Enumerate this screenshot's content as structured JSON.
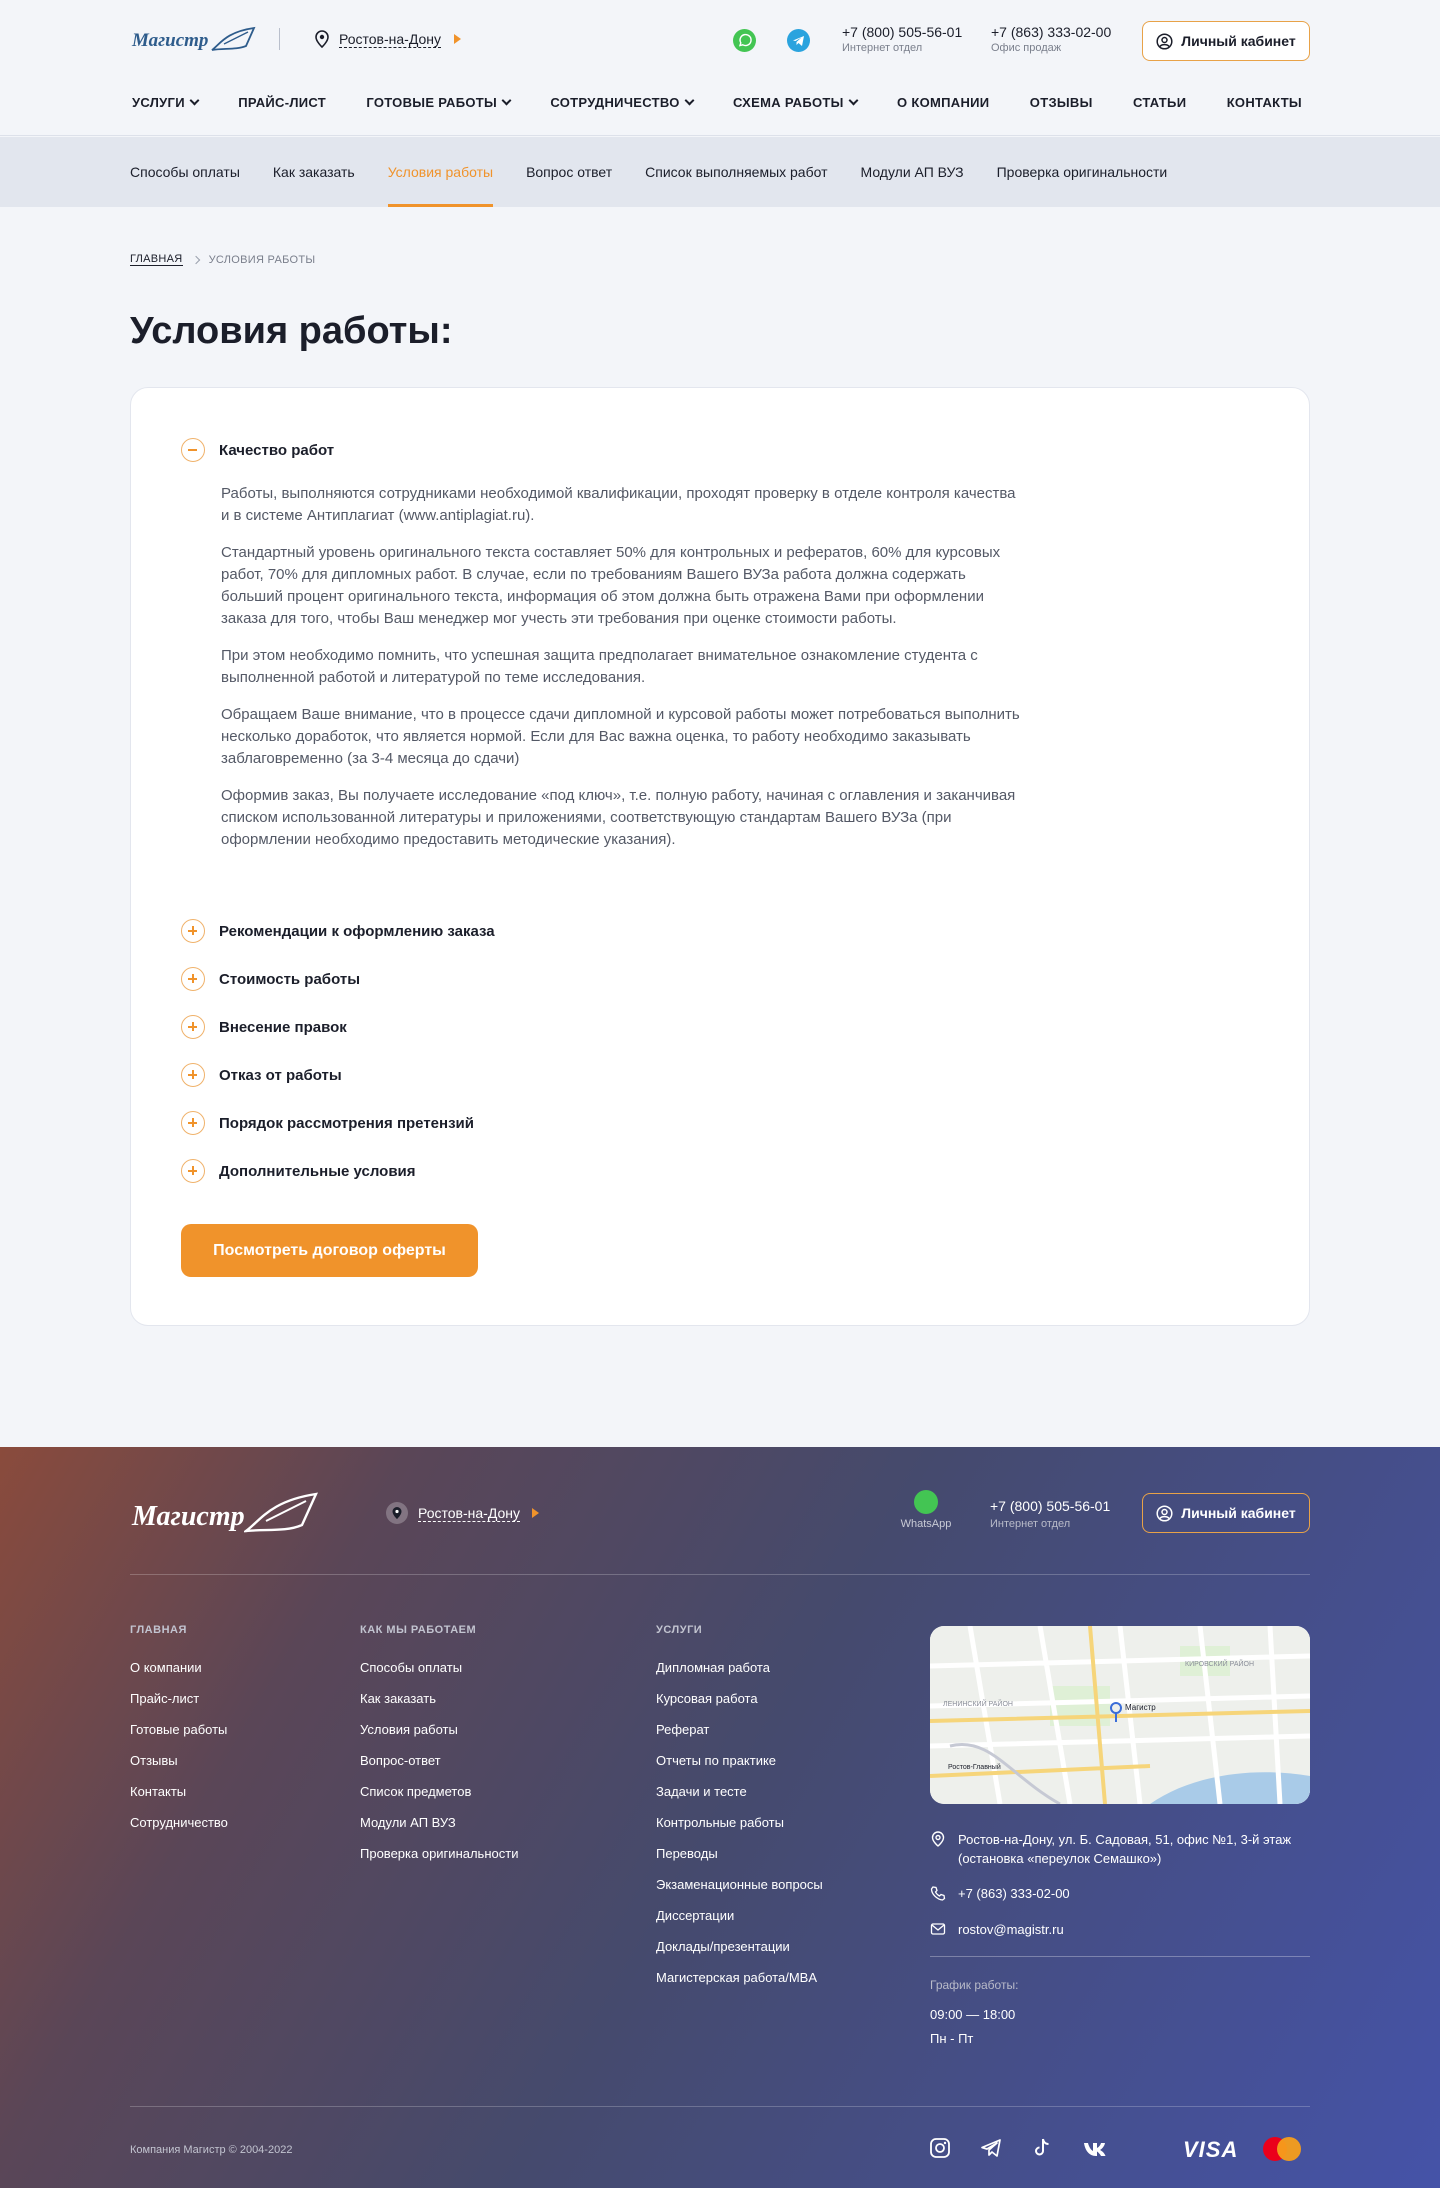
{
  "header": {
    "logo_text": "Магистр",
    "city": "Ростов-на-Дону",
    "phone1": {
      "number": "+7 (800) 505-56-01",
      "label": "Интернет отдел"
    },
    "phone2": {
      "number": "+7 (863) 333-02-00",
      "label": "Офис продаж"
    },
    "cabinet_label": "Личный кабинет",
    "nav": [
      "УСЛУГИ",
      "ПРАЙС-ЛИСТ",
      "ГОТОВЫЕ РАБОТЫ",
      "СОТРУДНИЧЕСТВО",
      "СХЕМА РАБОТЫ",
      "О КОМПАНИИ",
      "ОТЗЫВЫ",
      "СТАТЬИ",
      "КОНТАКТЫ"
    ]
  },
  "subnav": [
    "Способы оплаты",
    "Как заказать",
    "Условия работы",
    "Вопрос ответ",
    "Список выполняемых работ",
    "Модули АП ВУЗ",
    "Проверка оригинальности"
  ],
  "breadcrumb": {
    "home": "ГЛАВНАЯ",
    "current": "УСЛОВИЯ РАБОТЫ"
  },
  "page_title": "Условия работы:",
  "accordion": {
    "open_title": "Качество работ",
    "open_paragraphs": [
      "Работы, выполняются сотрудниками необходимой квалификации, проходят проверку в отделе контроля качества и в системе Антиплагиат (www.antiplagiat.ru).",
      "Стандартный уровень оригинального текста составляет 50% для контрольных и рефератов, 60% для курсовых работ, 70% для дипломных работ. В случае, если по требованиям Вашего ВУЗа работа должна содержать больший процент оригинального текста, информация об этом должна быть отражена Вами при оформлении заказа для того, чтобы Ваш менеджер мог учесть эти требования при оценке стоимости работы.",
      "При этом необходимо помнить, что успешная защита предполагает внимательное ознакомление студента с выполненной работой и литературой по теме исследования.",
      "Обращаем Ваше внимание, что в процессе сдачи дипломной и курсовой работы может потребоваться выполнить несколько доработок, что является нормой. Если для Вас важна оценка, то работу необходимо заказывать заблаговременно (за 3-4 месяца до сдачи)",
      "Оформив заказ, Вы получаете исследование «под ключ», т.е. полную работу, начиная с оглавления и заканчивая списком использованной литературы и приложениями, соответствующую стандартам Вашего ВУЗа (при оформлении необходимо предоставить методические указания)."
    ],
    "collapsed": [
      "Рекомендации к оформлению заказа",
      "Стоимость работы",
      "Внесение правок",
      "Отказ от работы",
      "Порядок рассмотрения претензий",
      "Дополнительные условия"
    ]
  },
  "offer_button": "Посмотреть договор оферты",
  "footer": {
    "logo_text": "Магистр",
    "city": "Ростов-на-Дону",
    "whatsapp": "WhatsApp",
    "phone": {
      "number": "+7 (800) 505-56-01",
      "label": "Интернет отдел"
    },
    "cabinet_label": "Личный кабинет",
    "col1": {
      "title": "ГЛАВНАЯ",
      "items": [
        "О компании",
        "Прайс-лист",
        "Готовые работы",
        "Отзывы",
        "Контакты",
        "Сотрудничество"
      ]
    },
    "col2": {
      "title": "КАК МЫ РАБОТАЕМ",
      "items": [
        "Способы оплаты",
        "Как заказать",
        "Условия работы",
        "Вопрос-ответ",
        "Список предметов",
        "Модули АП ВУЗ",
        "Проверка оригинальности"
      ]
    },
    "col3": {
      "title": "УСЛУГИ",
      "items": [
        "Дипломная работа",
        "Курсовая работа",
        "Реферат",
        "Отчеты по практике",
        "Задачи и тесте",
        "Контрольные работы",
        "Переводы",
        "Экзаменационные вопросы",
        "Диссертации",
        "Доклады/презентации",
        "Магистерская работа/MBA"
      ]
    },
    "address": "Ростов-на-Дону, ул. Б. Садовая, 51, офис №1, 3-й этаж (остановка «переулок Семашко»)",
    "office_phone": "+7 (863) 333-02-00",
    "email": "rostov@magistr.ru",
    "schedule_label": "График работы:",
    "schedule_hours": "09:00 — 18:00",
    "schedule_days": "Пн - Пт",
    "copyright": "Компания Магистр © 2004-2022",
    "visa": "VISA",
    "map_labels": {
      "district1": "ЛЕНИНСКИЙ РАЙОН",
      "district2": "КИРОВСКИЙ РАЙОН",
      "pin": "Магистр",
      "station": "Ростов-Главный"
    }
  },
  "colors": {
    "accent": "#f0932b",
    "text": "#1b1e2a",
    "whatsapp": "#43c553",
    "telegram": "#2aa3de"
  }
}
